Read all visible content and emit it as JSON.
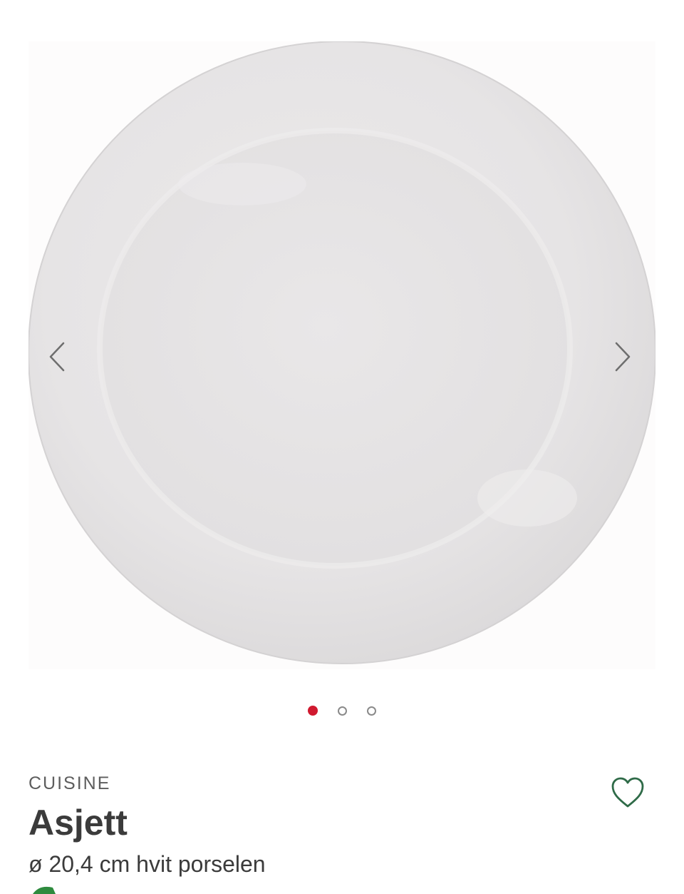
{
  "gallery": {
    "image_alt": "Asjett",
    "prev_icon": "chevron-left-icon",
    "next_icon": "chevron-right-icon",
    "slide_count": 3,
    "active_slide": 1,
    "colors": {
      "active_dot": "#d0192f",
      "inactive_dot": "#8a8a8a"
    }
  },
  "product": {
    "brand": "CUISINE",
    "name": "Asjett",
    "description": "ø 20,4 cm hvit porselen",
    "favorite_icon": "heart-outline-icon",
    "favorite_color": "#2f6b48"
  }
}
